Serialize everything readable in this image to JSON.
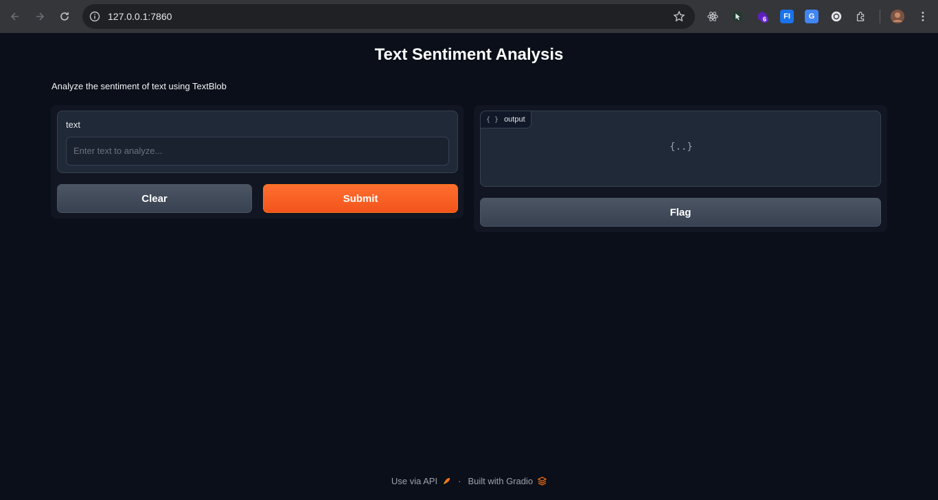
{
  "browser": {
    "url": "127.0.0.1:7860",
    "extensions": [
      {
        "name": "react-devtools-icon"
      },
      {
        "name": "cursor-extension-icon"
      },
      {
        "name": "purple-extension-icon",
        "badge": "6"
      },
      {
        "name": "fi-extension-icon",
        "text": "FI"
      },
      {
        "name": "google-translate-icon",
        "text": "G"
      },
      {
        "name": "openai-extension-icon"
      },
      {
        "name": "extensions-puzzle-icon"
      }
    ]
  },
  "app": {
    "title": "Text Sentiment Analysis",
    "description": "Analyze the sentiment of text using TextBlob"
  },
  "input": {
    "label": "text",
    "placeholder": "Enter text to analyze..."
  },
  "buttons": {
    "clear": "Clear",
    "submit": "Submit",
    "flag": "Flag"
  },
  "output": {
    "label": "output",
    "label_icon": "{ }",
    "empty_icon": "{..}"
  },
  "footer": {
    "api": "Use via API",
    "separator": "·",
    "built": "Built with Gradio"
  },
  "colors": {
    "background": "#0b0f19",
    "primary": "#f2541c",
    "secondary": "#374151"
  }
}
